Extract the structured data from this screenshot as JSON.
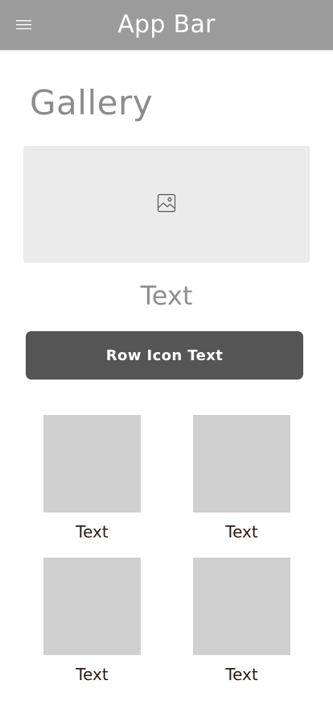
{
  "app_bar": {
    "title": "App Bar",
    "menu_icon": "hamburger-menu-icon"
  },
  "page": {
    "title": "Gallery"
  },
  "hero": {
    "icon": "image-placeholder-icon",
    "caption": "Text"
  },
  "action": {
    "label": "Row Icon Text"
  },
  "grid": {
    "items": [
      {
        "label": "Text"
      },
      {
        "label": "Text"
      },
      {
        "label": "Text"
      },
      {
        "label": "Text"
      }
    ]
  },
  "colors": {
    "app_bar_bg": "#9b9b9b",
    "button_bg": "#555555",
    "tile_bg": "#d0d0d0",
    "hero_bg": "#ebebeb"
  }
}
